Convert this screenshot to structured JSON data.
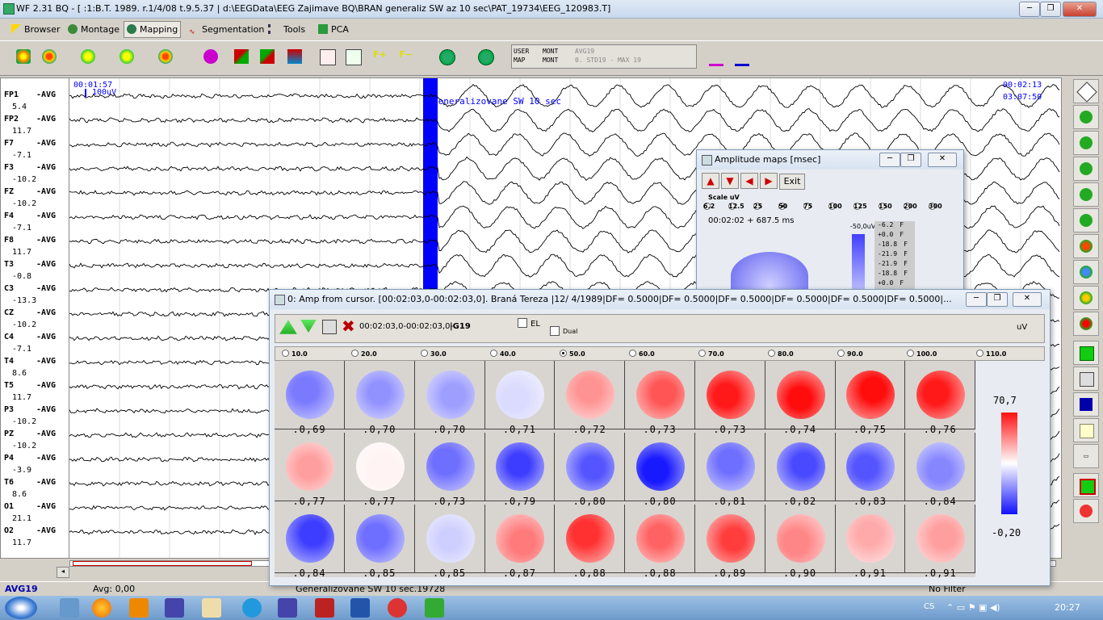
{
  "window": {
    "title": "WF 2.31 BQ - [                    :1:B.T. 1989.  r.1/4/08 t.9.5.37 | d:\\EEGData\\EEG Zajimave BQ\\BRAN generaliz SW az 10 sec\\PAT_19734\\EEG_120983.T]",
    "min": "─",
    "max": "❐",
    "close": "✕"
  },
  "menu": [
    {
      "label": "Browser",
      "icon": "pointer-icon"
    },
    {
      "label": "Montage",
      "icon": "montage-icon"
    },
    {
      "label": "Mapping",
      "icon": "mapping-icon"
    },
    {
      "label": "Segmentation",
      "icon": "segmentation-icon"
    },
    {
      "label": "Tools",
      "icon": "tools-icon"
    },
    {
      "label": "PCA",
      "icon": "pca-icon"
    }
  ],
  "montage_box": {
    "r1c1": "USER",
    "r1c2": "MONT",
    "r1c3": "AVG19",
    "r2c1": "MAP",
    "r2c2": "MONT",
    "r2c3": "0. STD19 - MAX 19"
  },
  "eeg": {
    "time_start": "00:01:57",
    "scale_label": "100uV",
    "time_end": "00:02:13",
    "clock": "03:07:50",
    "event_label": "Generalizovane SW 10 sec",
    "channels": [
      {
        "name": "FP1",
        "ref": "-AVG",
        "val": "5.4"
      },
      {
        "name": "FP2",
        "ref": "-AVG",
        "val": "11.7"
      },
      {
        "name": "F7",
        "ref": "-AVG",
        "val": "-7.1"
      },
      {
        "name": "F3",
        "ref": "-AVG",
        "val": "-10.2"
      },
      {
        "name": "FZ",
        "ref": "-AVG",
        "val": "-10.2"
      },
      {
        "name": "F4",
        "ref": "-AVG",
        "val": "-7.1"
      },
      {
        "name": "F8",
        "ref": "-AVG",
        "val": "11.7"
      },
      {
        "name": "T3",
        "ref": "-AVG",
        "val": "-0.8"
      },
      {
        "name": "C3",
        "ref": "-AVG",
        "val": "-13.3"
      },
      {
        "name": "CZ",
        "ref": "-AVG",
        "val": "-10.2"
      },
      {
        "name": "C4",
        "ref": "-AVG",
        "val": "-7.1"
      },
      {
        "name": "T4",
        "ref": "-AVG",
        "val": "8.6"
      },
      {
        "name": "T5",
        "ref": "-AVG",
        "val": "11.7"
      },
      {
        "name": "P3",
        "ref": "-AVG",
        "val": "-10.2"
      },
      {
        "name": "PZ",
        "ref": "-AVG",
        "val": "-10.2"
      },
      {
        "name": "P4",
        "ref": "-AVG",
        "val": "-3.9"
      },
      {
        "name": "T6",
        "ref": "-AVG",
        "val": "8.6"
      },
      {
        "name": "O1",
        "ref": "-AVG",
        "val": "21.1"
      },
      {
        "name": "O2",
        "ref": "-AVG",
        "val": "11.7"
      }
    ]
  },
  "amp_window": {
    "title": "Amplitude maps [msec]",
    "exit": "Exit",
    "scale_title": "Scale uV",
    "scales": [
      "6.2",
      "12.5",
      "25",
      "50",
      "75",
      "100",
      "125",
      "150",
      "200",
      "300"
    ],
    "scale_selected": "50",
    "time": "00:02:02 + 687.5 ms",
    "bar_top": "-50,0uV",
    "values": [
      "-6.2",
      "+0.0",
      "-18.8",
      "-21.9",
      "-21.9",
      "-18.8",
      "+0.0"
    ],
    "val_suffix": "F"
  },
  "maps_window": {
    "title": "0: Amp from cursor. [00:02:03,0-00:02:03,0]. Braná        Tereza        |12/ 4/1989|DF=  0.5000|DF=  0.5000|DF=  0.5000|DF=  0.5000|DF=  0.5000|DF=  0.5000|...",
    "range": "00:02:03,0-00:02:03,0-",
    "montage": "|G19",
    "el_label": "EL",
    "dual_label": "Dual",
    "unit": "uV",
    "steps": [
      "10.0",
      "20.0",
      "30.0",
      "40.0",
      "50.0",
      "60.0",
      "70.0",
      "80.0",
      "90.0",
      "100.0",
      "110.0"
    ],
    "step_selected": "50.0",
    "color_max": "70,7",
    "color_min": "-0,20",
    "maps": [
      {
        "label": ".0,69",
        "level": -0.55
      },
      {
        "label": ".0,70",
        "level": -0.45
      },
      {
        "label": ".0,70",
        "level": -0.4
      },
      {
        "label": ".0,71",
        "level": -0.15
      },
      {
        "label": ".0,72",
        "level": 0.45
      },
      {
        "label": ".0,73",
        "level": 0.7
      },
      {
        "label": ".0,73",
        "level": 0.95
      },
      {
        "label": ".0,74",
        "level": 1.0
      },
      {
        "label": ".0,75",
        "level": 1.0
      },
      {
        "label": ".0,76",
        "level": 0.95
      },
      {
        "label": ".0,77",
        "level": 0.4
      },
      {
        "label": ".0,77",
        "level": 0.05
      },
      {
        "label": ".0,73",
        "level": -0.6
      },
      {
        "label": ".0,79",
        "level": -0.8
      },
      {
        "label": ".0,80",
        "level": -0.7
      },
      {
        "label": ".0,80",
        "level": -0.95
      },
      {
        "label": ".0,81",
        "level": -0.6
      },
      {
        "label": ".0,82",
        "level": -0.75
      },
      {
        "label": ".0,83",
        "level": -0.7
      },
      {
        "label": ".0,84",
        "level": -0.5
      },
      {
        "label": ".0,84",
        "level": -0.8
      },
      {
        "label": ".0,85",
        "level": -0.6
      },
      {
        "label": ".0,85",
        "level": -0.2
      },
      {
        "label": ".0,87",
        "level": 0.55
      },
      {
        "label": ".0,88",
        "level": 0.85
      },
      {
        "label": ".0,88",
        "level": 0.65
      },
      {
        "label": ".0,89",
        "level": 0.8
      },
      {
        "label": ".0,90",
        "level": 0.5
      },
      {
        "label": ".0,91",
        "level": 0.35
      },
      {
        "label": ".0,91",
        "level": 0.4
      }
    ]
  },
  "status": {
    "montage": "AVG19",
    "avg": "Avg: 0,00",
    "event": "Generalizovane SW 10 sec.19728",
    "filter": "No Filter"
  },
  "taskbar": {
    "lang": "CS",
    "clock": "20:27"
  },
  "colors": {
    "blue": "#2020ff",
    "red": "#ff2020",
    "eeg_line": "#000000",
    "marker": "#0000ff",
    "time_text": "#0000ff"
  }
}
